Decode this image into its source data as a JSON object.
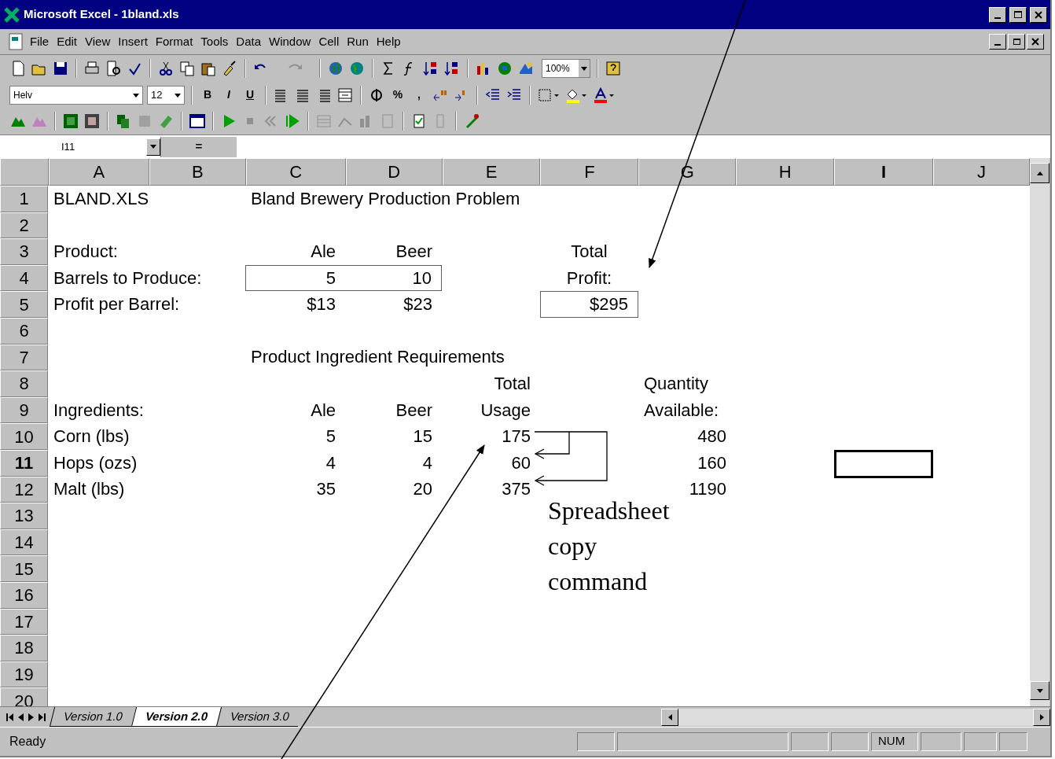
{
  "window": {
    "title": "Microsoft Excel - 1bland.xls"
  },
  "menu": [
    "File",
    "Edit",
    "View",
    "Insert",
    "Format",
    "Tools",
    "Data",
    "Window",
    "Cell",
    "Run",
    "Help"
  ],
  "standard_toolbar": {
    "zoom": "100%"
  },
  "formatting_toolbar": {
    "font": "Helv",
    "size": "12",
    "bold": "B",
    "italic": "I",
    "underline": "U",
    "percent": "%",
    "comma": ","
  },
  "formula_bar": {
    "name_box": "I11",
    "equals": "="
  },
  "columns": [
    {
      "label": "A",
      "selected": false
    },
    {
      "label": "B",
      "selected": false
    },
    {
      "label": "C",
      "selected": false
    },
    {
      "label": "D",
      "selected": false
    },
    {
      "label": "E",
      "selected": false
    },
    {
      "label": "F",
      "selected": false
    },
    {
      "label": "G",
      "selected": false
    },
    {
      "label": "H",
      "selected": false
    },
    {
      "label": "I",
      "selected": true
    },
    {
      "label": "J",
      "selected": false
    }
  ],
  "rows": [
    {
      "label": "1",
      "selected": false,
      "cells": {
        "A": {
          "text": "BLAND.XLS",
          "kind": "text"
        },
        "C": {
          "text": "Bland Brewery Production Problem",
          "kind": "text"
        }
      }
    },
    {
      "label": "2",
      "selected": false,
      "cells": {}
    },
    {
      "label": "3",
      "selected": false,
      "cells": {
        "A": {
          "text": "Product:",
          "kind": "text"
        },
        "C": {
          "text": "Ale",
          "kind": "number"
        },
        "D": {
          "text": "Beer",
          "kind": "number"
        },
        "F": {
          "text": "Total",
          "kind": "centered"
        }
      }
    },
    {
      "label": "4",
      "selected": false,
      "cells": {
        "A": {
          "text": "Barrels to Produce:",
          "kind": "text"
        },
        "C": {
          "text": "5",
          "kind": "number",
          "boxed": true
        },
        "D": {
          "text": "10",
          "kind": "number",
          "boxed": true
        },
        "F": {
          "text": "Profit:",
          "kind": "centered"
        }
      }
    },
    {
      "label": "5",
      "selected": false,
      "cells": {
        "A": {
          "text": "Profit per Barrel:",
          "kind": "text"
        },
        "C": {
          "text": "$13",
          "kind": "number"
        },
        "D": {
          "text": "$23",
          "kind": "number"
        },
        "F": {
          "text": "$295",
          "kind": "number",
          "boxed": true
        }
      }
    },
    {
      "label": "6",
      "selected": false,
      "cells": {}
    },
    {
      "label": "7",
      "selected": false,
      "cells": {
        "C": {
          "text": "Product Ingredient Requirements",
          "kind": "text"
        }
      }
    },
    {
      "label": "8",
      "selected": false,
      "cells": {
        "E": {
          "text": "Total",
          "kind": "number"
        },
        "G": {
          "text": "Quantity",
          "kind": "text"
        }
      }
    },
    {
      "label": "9",
      "selected": false,
      "cells": {
        "A": {
          "text": "Ingredients:",
          "kind": "text"
        },
        "C": {
          "text": "Ale",
          "kind": "number"
        },
        "D": {
          "text": "Beer",
          "kind": "number"
        },
        "E": {
          "text": "Usage",
          "kind": "number"
        },
        "G": {
          "text": "Available:",
          "kind": "text"
        }
      }
    },
    {
      "label": "10",
      "selected": false,
      "cells": {
        "A": {
          "text": "Corn (lbs)",
          "kind": "text"
        },
        "C": {
          "text": "5",
          "kind": "number"
        },
        "D": {
          "text": "15",
          "kind": "number"
        },
        "E": {
          "text": "175",
          "kind": "number"
        },
        "G": {
          "text": "480",
          "kind": "number"
        }
      }
    },
    {
      "label": "11",
      "selected": true,
      "cells": {
        "A": {
          "text": "Hops (ozs)",
          "kind": "text"
        },
        "C": {
          "text": "4",
          "kind": "number"
        },
        "D": {
          "text": "4",
          "kind": "number"
        },
        "E": {
          "text": "60",
          "kind": "number"
        },
        "G": {
          "text": "160",
          "kind": "number"
        }
      }
    },
    {
      "label": "12",
      "selected": false,
      "cells": {
        "A": {
          "text": "Malt (lbs)",
          "kind": "text"
        },
        "C": {
          "text": "35",
          "kind": "number"
        },
        "D": {
          "text": "20",
          "kind": "number"
        },
        "E": {
          "text": "375",
          "kind": "number"
        },
        "G": {
          "text": "1190",
          "kind": "number"
        }
      }
    },
    {
      "label": "13",
      "selected": false,
      "cells": {}
    },
    {
      "label": "14",
      "selected": false,
      "cells": {}
    },
    {
      "label": "15",
      "selected": false,
      "cells": {}
    },
    {
      "label": "16",
      "selected": false,
      "cells": {}
    },
    {
      "label": "17",
      "selected": false,
      "cells": {}
    },
    {
      "label": "18",
      "selected": false,
      "cells": {}
    },
    {
      "label": "19",
      "selected": false,
      "cells": {}
    },
    {
      "label": "20",
      "selected": false,
      "cells": {}
    }
  ],
  "sheet_tabs": [
    {
      "label": "Version 1.0",
      "selected": false
    },
    {
      "label": "Version 2.0",
      "selected": true
    },
    {
      "label": "Version 3.0",
      "selected": false
    }
  ],
  "status_bar": {
    "text": "Ready",
    "indicator": "NUM"
  },
  "annotation": {
    "note": "Spreadsheet copy command"
  }
}
